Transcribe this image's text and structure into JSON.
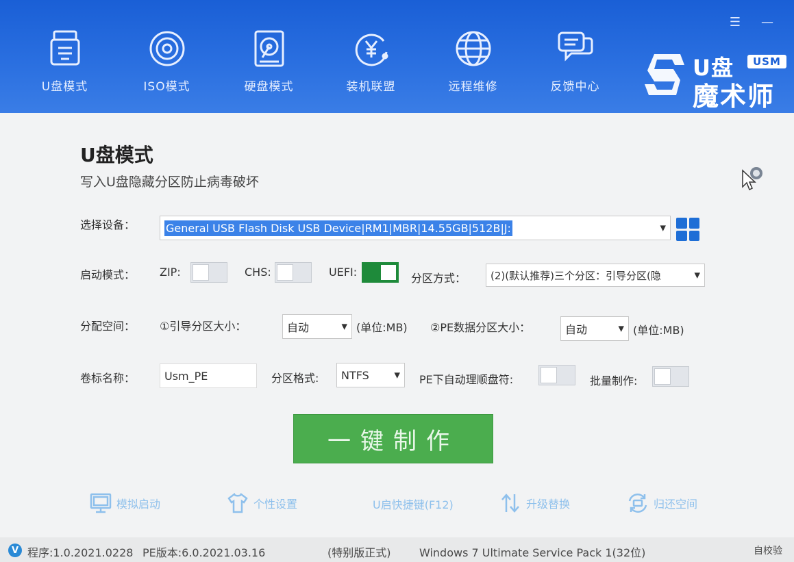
{
  "window": {
    "menu_glyph": "☰",
    "minimize_glyph": "—"
  },
  "nav": {
    "items": [
      {
        "label": "U盘模式",
        "icon": "usb-drive-icon"
      },
      {
        "label": "ISO模式",
        "icon": "disc-icon"
      },
      {
        "label": "硬盘模式",
        "icon": "hard-disk-icon"
      },
      {
        "label": "装机联盟",
        "icon": "yuan-coin-icon"
      },
      {
        "label": "远程维修",
        "icon": "globe-icon"
      },
      {
        "label": "反馈中心",
        "icon": "feedback-icon"
      }
    ]
  },
  "brand": {
    "line1": "U盘",
    "badge": "USM",
    "line2": "魔术师"
  },
  "page": {
    "title": "U盘模式",
    "subtitle": "写入U盘隐藏分区防止病毒破坏"
  },
  "device": {
    "label": "选择设备：",
    "value": "General USB Flash Disk USB Device|RM1|MBR|14.55GB|512B|J:"
  },
  "boot": {
    "label": "启动模式：",
    "zip_label": "ZIP:",
    "chs_label": "CHS:",
    "uefi_label": "UEFI:",
    "zip_on": false,
    "chs_on": false,
    "uefi_on": true,
    "partition_label": "分区方式：",
    "partition_value": "(2)(默认推荐)三个分区：引导分区(隐"
  },
  "space": {
    "label": "分配空间：",
    "boot_size_label": "①引导分区大小：",
    "boot_size_value": "自动",
    "boot_unit": "(单位:MB)",
    "pe_size_label": "②PE数据分区大小：",
    "pe_size_value": "自动",
    "pe_unit": "(单位:MB)"
  },
  "volume": {
    "label": "卷标名称：",
    "value": "Usm_PE",
    "format_label": "分区格式:",
    "format_value": "NTFS",
    "auto_letter_label": "PE下自动理顺盘符:",
    "auto_letter_on": false,
    "batch_label": "批量制作:",
    "batch_on": false
  },
  "make_button": "一键制作",
  "tools": [
    {
      "label": "模拟启动",
      "icon": "monitor-icon"
    },
    {
      "label": "个性设置",
      "icon": "tshirt-icon"
    },
    {
      "label": "U启快捷键(F12)",
      "icon": ""
    },
    {
      "label": "升级替换",
      "icon": "up-down-arrows-icon"
    },
    {
      "label": "归还空间",
      "icon": "refresh-drive-icon"
    }
  ],
  "status": {
    "badge": "V",
    "program_version": "程序:1.0.2021.0228",
    "pe_version": "PE版本:6.0.2021.03.16",
    "edition": "(特别版正式)",
    "os": "Windows 7 Ultimate Service Pack 1(32位)",
    "self_check": "自校验"
  },
  "colors": {
    "header_blue": "#2a6fe0",
    "accent_green": "#4bad4e",
    "toggle_on": "#1e8a3a",
    "selection_blue": "#3b82e8"
  }
}
